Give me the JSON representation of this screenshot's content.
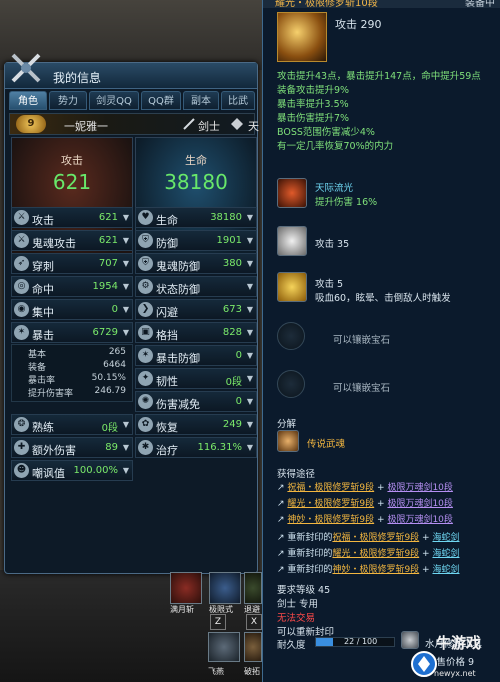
{
  "panel": {
    "title": "我的信息",
    "tabs": [
      "角色",
      "势力",
      "剑灵QQ",
      "QQ群",
      "副本",
      "比武"
    ],
    "level_badge": "9",
    "player_name": "一妮雅一",
    "class": "剑士",
    "server": "天"
  },
  "big": {
    "attack_label": "攻击",
    "attack_value": "621",
    "hp_label": "生命",
    "hp_value": "38180"
  },
  "left_stats": [
    {
      "label": "攻击",
      "value": "621"
    },
    {
      "label": "鬼魂攻击",
      "value": "621"
    },
    {
      "label": "穿刺",
      "value": "707"
    },
    {
      "label": "命中",
      "value": "1954"
    },
    {
      "label": "集中",
      "value": "0"
    },
    {
      "label": "暴击",
      "value": "6729"
    }
  ],
  "crit_detail": [
    {
      "label": "基本",
      "value": "265"
    },
    {
      "label": "装备",
      "value": "6464"
    },
    {
      "label": "暴击率",
      "value": "50.15%"
    },
    {
      "label": "提升伤害率",
      "value": "246.79"
    }
  ],
  "left_stats_2": [
    {
      "label": "熟练",
      "value": "0段"
    },
    {
      "label": "额外伤害",
      "value": "89"
    },
    {
      "label": "嘲讽值",
      "value": "100.00%"
    }
  ],
  "right_stats": [
    {
      "label": "生命",
      "value": "38180"
    },
    {
      "label": "防御",
      "value": "1901"
    },
    {
      "label": "鬼魂防御",
      "value": "380"
    },
    {
      "label": "状态防御",
      "value": ""
    },
    {
      "label": "闪避",
      "value": "673"
    },
    {
      "label": "格挡",
      "value": "828"
    },
    {
      "label": "暴击防御",
      "value": "0"
    },
    {
      "label": "韧性",
      "value": "0段"
    },
    {
      "label": "伤害减免",
      "value": "0"
    },
    {
      "label": "恢复",
      "value": "249"
    },
    {
      "label": "治疗",
      "value": "116.31%"
    }
  ],
  "tooltip": {
    "header": "耀光・极限修罗斩10段",
    "header_right": "装备中",
    "attack": "攻击 290",
    "effects": [
      "攻击提升43点，暴击提升147点，命中提升59点",
      "装备攻击提升9%",
      "暴击率提升3.5%",
      "暴击伤害提升7%",
      "BOSS范围伤害减少4%",
      "有一定几率恢复70%的内力"
    ],
    "skill_name": "天际流光",
    "skill_effect": "提升伤害 16%",
    "gem1": "攻击 35",
    "gem2_line1": "攻击 5",
    "gem2_line2": "吸血60，眩晕、击倒敌人时触发",
    "empty_slot1": "可以镶嵌宝石",
    "empty_slot2": "可以镶嵌宝石",
    "decompose_label": "分解",
    "decompose_item": "传说武魂",
    "obtain_label": "获得途径",
    "sources": [
      {
        "a": "祝福・极限修罗斩9段",
        "b": "极限万魂剑10段"
      },
      {
        "a": "耀光・极限修罗斩9段",
        "b": "极限万魂剑10段"
      },
      {
        "a": "神妙・极限修罗斩9段",
        "b": "极限万魂剑10段"
      }
    ],
    "reseal": [
      {
        "pre": "重新封印的",
        "a": "祝福・极限修罗斩9段",
        "b": "海蛇剑"
      },
      {
        "pre": "重新封印的",
        "a": "耀光・极限修罗斩9段",
        "b": "海蛇剑"
      },
      {
        "pre": "重新封印的",
        "a": "神妙・极限修罗斩9段",
        "b": "海蛇剑"
      }
    ],
    "req_level": "要求等级 45",
    "req_class": "剑士 专用",
    "no_trade": "无法交易",
    "can_reseal": "可以重新封印",
    "durability_label": "耐久度",
    "durability_text": "22 / 100",
    "durability_fraction": 0.22,
    "repair_tool": "水月修理工具",
    "sell_price": "出售价格 9"
  },
  "skills": [
    {
      "name": "满月斩",
      "key": "Z"
    },
    {
      "name": "极限式",
      "key": "X"
    },
    {
      "name": "退避",
      "key": ""
    },
    {
      "name": "飞燕",
      "key": ""
    },
    {
      "name": "破拓",
      "key": ""
    }
  ],
  "watermark": {
    "text": "牛游戏",
    "url": "newyx.net"
  }
}
